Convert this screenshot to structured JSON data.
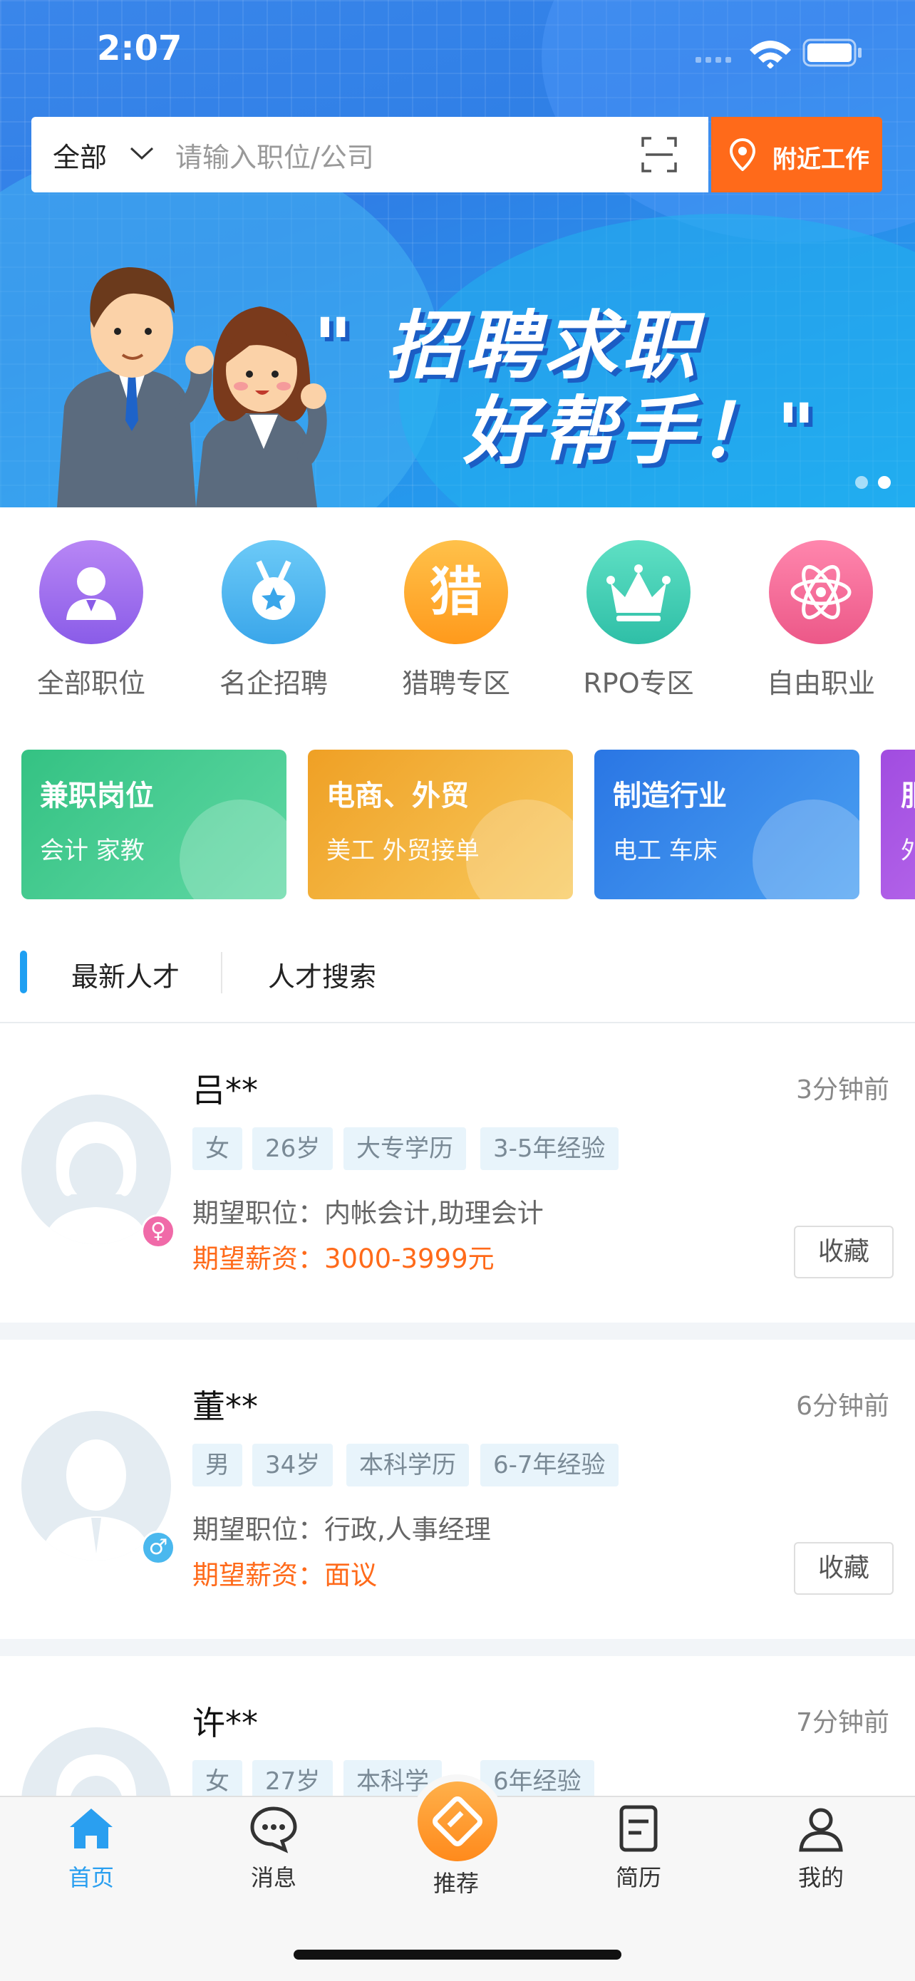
{
  "status": {
    "time": "2:07"
  },
  "search": {
    "category": "全部",
    "placeholder": "请输入职位/公司",
    "nearby_label": "附近工作"
  },
  "banner": {
    "line1": "\" 招聘求职",
    "line2": "好帮手！\""
  },
  "quick_links": [
    {
      "label": "全部职位",
      "icon": "user-badge-icon",
      "color": "#9b6cf0"
    },
    {
      "label": "名企招聘",
      "icon": "medal-icon",
      "color": "#3fb2ef"
    },
    {
      "label": "猎聘专区",
      "icon": "hunt-icon",
      "glyph": "猎",
      "color": "#ff9f1c"
    },
    {
      "label": "RPO专区",
      "icon": "crown-icon",
      "color": "#2fcfb4"
    },
    {
      "label": "自由职业",
      "icon": "atom-icon",
      "color": "#f0618f"
    }
  ],
  "categories": [
    {
      "title": "兼职岗位",
      "subs": "会计    家教",
      "color1": "#38c98a",
      "color2": "#5ad6a0"
    },
    {
      "title": "电商、外贸",
      "subs": "美工    外贸接单",
      "color1": "#f0a52c",
      "color2": "#f7c65a"
    },
    {
      "title": "制造行业",
      "subs": "电工    车床",
      "color1": "#2b7ee8",
      "color2": "#4a9bf0"
    },
    {
      "title": "服",
      "subs": "外",
      "color1": "#a44fe0",
      "color2": "#c27af0"
    }
  ],
  "tabs": {
    "active": "最新人才",
    "other": "人才搜索"
  },
  "talents": [
    {
      "name": "吕**",
      "time": "3分钟前",
      "tags": [
        "女",
        "26岁",
        "大专学历",
        "3-5年经验"
      ],
      "expect": "期望职位：内帐会计,助理会计",
      "salary_label": "期望薪资：",
      "salary": "3000-3999元",
      "fav": "收藏",
      "gender_symbol": "♀",
      "gender_color": "#f06aa8"
    },
    {
      "name": "董**",
      "time": "6分钟前",
      "tags": [
        "男",
        "34岁",
        "本科学历",
        "6-7年经验"
      ],
      "expect": "期望职位：行政,人事经理",
      "salary_label": "期望薪资：",
      "salary": "面议",
      "fav": "收藏",
      "gender_symbol": "♂",
      "gender_color": "#4ab8ee"
    },
    {
      "name": "许**",
      "time": "7分钟前",
      "tags": [
        "女",
        "27岁",
        "本科学",
        "6年经验"
      ]
    }
  ],
  "tabbar": [
    {
      "label": "首页",
      "icon": "home-icon",
      "active": true
    },
    {
      "label": "消息",
      "icon": "chat-icon"
    },
    {
      "label": "推荐",
      "icon": "recommend-icon"
    },
    {
      "label": "简历",
      "icon": "resume-icon"
    },
    {
      "label": "我的",
      "icon": "profile-icon"
    }
  ],
  "colors": {
    "accent": "#1e9ff2",
    "orange": "#ff6a1a"
  }
}
